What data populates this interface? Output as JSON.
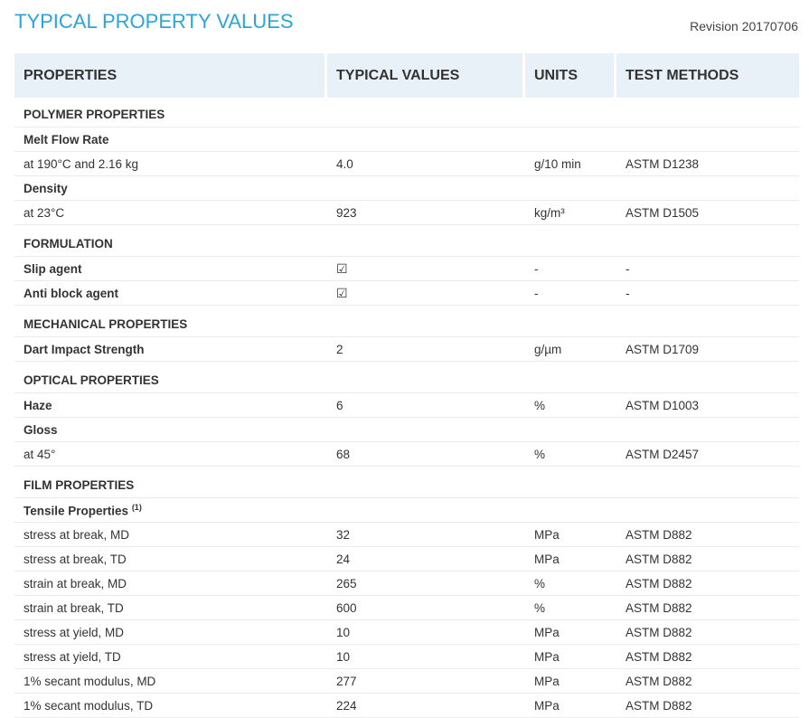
{
  "header": {
    "title": "TYPICAL PROPERTY VALUES",
    "revision": "Revision 20170706"
  },
  "table": {
    "columns": [
      "PROPERTIES",
      "TYPICAL VALUES",
      "UNITS",
      "TEST METHODS"
    ],
    "rows": [
      {
        "kind": "sec",
        "property": "POLYMER PROPERTIES",
        "value": "",
        "unit": "",
        "method": ""
      },
      {
        "kind": "sub",
        "property": "Melt Flow Rate",
        "value": "",
        "unit": "",
        "method": ""
      },
      {
        "kind": "val",
        "property": "at 190°C and 2.16 kg",
        "value": "4.0",
        "unit": "g/10 min",
        "method": "ASTM D1238"
      },
      {
        "kind": "sub",
        "property": "Density",
        "value": "",
        "unit": "",
        "method": ""
      },
      {
        "kind": "val",
        "property": "at 23°C",
        "value": "923",
        "unit": "kg/m³",
        "method": "ASTM D1505"
      },
      {
        "kind": "sec",
        "property": "FORMULATION",
        "value": "",
        "unit": "",
        "method": ""
      },
      {
        "kind": "sub",
        "property": "Slip agent",
        "value": "☑",
        "unit": "-",
        "method": "-"
      },
      {
        "kind": "sub",
        "property": "Anti block agent",
        "value": "☑",
        "unit": "-",
        "method": "-"
      },
      {
        "kind": "sec",
        "property": "MECHANICAL PROPERTIES",
        "value": "",
        "unit": "",
        "method": ""
      },
      {
        "kind": "sub",
        "property": "Dart Impact Strength",
        "value": "2",
        "unit": "g/µm",
        "method": "ASTM D1709"
      },
      {
        "kind": "sec",
        "property": "OPTICAL PROPERTIES",
        "value": "",
        "unit": "",
        "method": ""
      },
      {
        "kind": "sub",
        "property": "Haze",
        "value": "6",
        "unit": "%",
        "method": "ASTM D1003"
      },
      {
        "kind": "sub",
        "property": "Gloss",
        "value": "",
        "unit": "",
        "method": ""
      },
      {
        "kind": "val",
        "property": "at 45°",
        "value": "68",
        "unit": "%",
        "method": "ASTM D2457"
      },
      {
        "kind": "sec",
        "property": "FILM PROPERTIES",
        "value": "",
        "unit": "",
        "method": ""
      },
      {
        "kind": "sub",
        "property": "Tensile Properties",
        "note": "(1)",
        "value": "",
        "unit": "",
        "method": ""
      },
      {
        "kind": "val",
        "property": "stress at break, MD",
        "value": "32",
        "unit": "MPa",
        "method": "ASTM D882"
      },
      {
        "kind": "val",
        "property": "stress at break, TD",
        "value": "24",
        "unit": "MPa",
        "method": "ASTM D882"
      },
      {
        "kind": "val",
        "property": "strain at break, MD",
        "value": "265",
        "unit": "%",
        "method": "ASTM D882"
      },
      {
        "kind": "val",
        "property": "strain at break, TD",
        "value": "600",
        "unit": "%",
        "method": "ASTM D882"
      },
      {
        "kind": "val",
        "property": "stress at yield, MD",
        "value": "10",
        "unit": "MPa",
        "method": "ASTM D882"
      },
      {
        "kind": "val",
        "property": "stress at yield, TD",
        "value": "10",
        "unit": "MPa",
        "method": "ASTM D882"
      },
      {
        "kind": "val",
        "property": "1% secant modulus, MD",
        "value": "277",
        "unit": "MPa",
        "method": "ASTM D882"
      },
      {
        "kind": "val",
        "property": "1% secant modulus, TD",
        "value": "224",
        "unit": "MPa",
        "method": "ASTM D882"
      }
    ]
  }
}
